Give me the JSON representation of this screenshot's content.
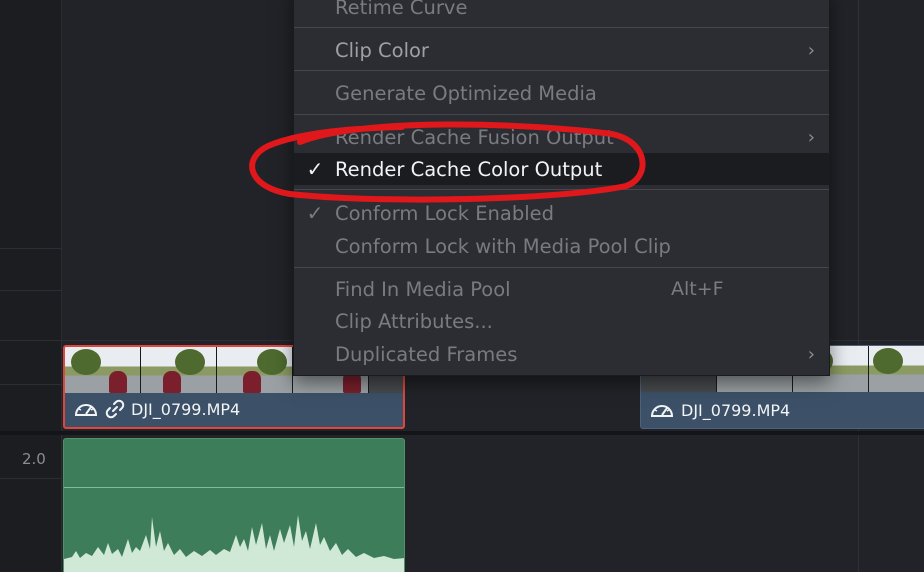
{
  "timeline": {
    "audio_track_level": "2.0",
    "video_clips": [
      {
        "name": "DJI_0799.MP4",
        "selected": true
      },
      {
        "name": "DJI_0799.MP4",
        "selected": false
      }
    ]
  },
  "context_menu": {
    "items": [
      {
        "label": "Retime Curve",
        "checked": false,
        "submenu": false,
        "shortcut": ""
      },
      {
        "label": "Clip Color",
        "checked": false,
        "submenu": true,
        "shortcut": ""
      },
      {
        "label": "Generate Optimized Media",
        "checked": false,
        "submenu": false,
        "shortcut": ""
      },
      {
        "label": "Render Cache Fusion Output",
        "checked": false,
        "submenu": true,
        "shortcut": ""
      },
      {
        "label": "Render Cache Color Output",
        "checked": true,
        "submenu": false,
        "shortcut": ""
      },
      {
        "label": "Conform Lock Enabled",
        "checked": true,
        "submenu": false,
        "shortcut": ""
      },
      {
        "label": "Conform Lock with Media Pool Clip",
        "checked": false,
        "submenu": false,
        "shortcut": ""
      },
      {
        "label": "Find In Media Pool",
        "checked": false,
        "submenu": false,
        "shortcut": "Alt+F"
      },
      {
        "label": "Clip Attributes...",
        "checked": false,
        "submenu": false,
        "shortcut": ""
      },
      {
        "label": "Duplicated Frames",
        "checked": false,
        "submenu": true,
        "shortcut": ""
      }
    ],
    "check_glyph": "✓",
    "submenu_glyph": "›"
  },
  "icons": {
    "retime": "speedometer-icon",
    "link": "link-icon"
  },
  "colors": {
    "selection_outline": "#e0463c",
    "annotation_circle": "#e0181c",
    "video_clip": "#3c5168",
    "audio_clip": "#3e7d59"
  }
}
